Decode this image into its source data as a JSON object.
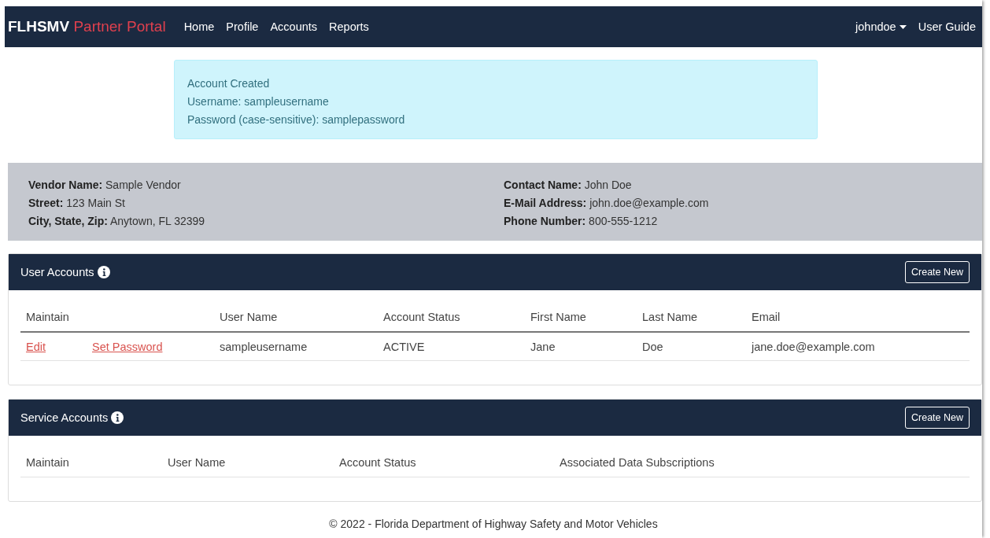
{
  "navbar": {
    "brand": "FLHSMV",
    "brand_suffix": "Partner Portal",
    "links": [
      "Home",
      "Profile",
      "Accounts",
      "Reports"
    ],
    "user_menu": "johndoe",
    "user_guide": "User Guide"
  },
  "alert": {
    "lines": [
      "Account Created",
      "Username: sampleusername",
      "Password (case-sensitive): samplepassword"
    ]
  },
  "vendor": {
    "left": [
      {
        "label": "Vendor Name:",
        "value": "Sample Vendor"
      },
      {
        "label": "Street:",
        "value": "123 Main St"
      },
      {
        "label": "City, State, Zip:",
        "value": "Anytown, FL 32399"
      }
    ],
    "right": [
      {
        "label": "Contact Name:",
        "value": "John Doe"
      },
      {
        "label": "E-Mail Address:",
        "value": "john.doe@example.com"
      },
      {
        "label": "Phone Number:",
        "value": "800-555-1212"
      }
    ]
  },
  "sections": [
    {
      "title": "User Accounts",
      "button": "Create New",
      "columns": [
        "Maintain",
        "User Name",
        "Account Status",
        "First Name",
        "Last Name",
        "Email"
      ],
      "rows": [
        {
          "cells": [
            {
              "kind": "links",
              "links": [
                "Edit",
                "Set Password"
              ]
            },
            {
              "kind": "text",
              "text": "sampleusername"
            },
            {
              "kind": "text",
              "text": "ACTIVE"
            },
            {
              "kind": "text",
              "text": "Jane"
            },
            {
              "kind": "text",
              "text": "Doe"
            },
            {
              "kind": "text",
              "text": "jane.doe@example.com"
            }
          ]
        }
      ]
    },
    {
      "title": "Service Accounts",
      "button": "Create New",
      "columns": [
        "Maintain",
        "User Name",
        "Account Status",
        "Associated Data Subscriptions"
      ]
    }
  ],
  "footer": "© 2022 - Florida Department of Highway Safety and Motor Vehicles"
}
